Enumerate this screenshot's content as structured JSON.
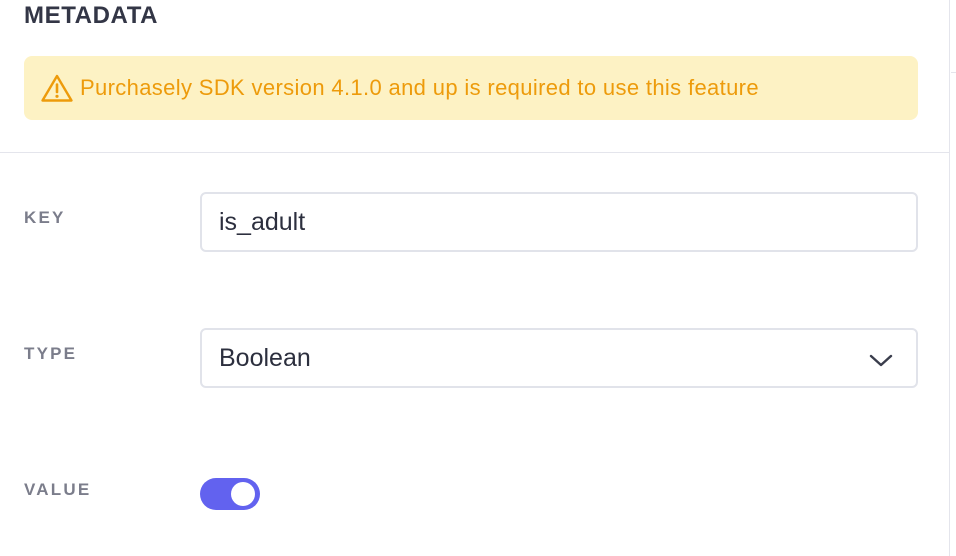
{
  "section": {
    "title": "METADATA"
  },
  "alert": {
    "icon": "warning-icon",
    "text": "Purchasely SDK version 4.1.0 and up is required to use this feature",
    "bg_color": "#fdf2c4",
    "text_color": "#ed9b0b"
  },
  "fields": {
    "key": {
      "label": "KEY",
      "value": "is_adult"
    },
    "type": {
      "label": "TYPE",
      "selected": "Boolean",
      "icon": "chevron-down-icon"
    },
    "value": {
      "label": "VALUE",
      "toggle_on": true,
      "accent_color": "#6262ef"
    }
  }
}
